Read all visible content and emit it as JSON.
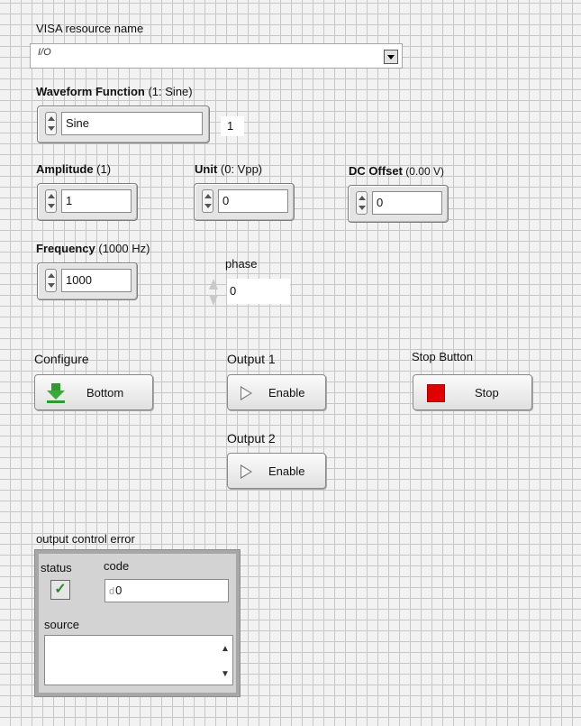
{
  "visa": {
    "label": "VISA resource name",
    "io_glyph": "I/O",
    "value": ""
  },
  "waveform": {
    "label_bold": "Waveform Function",
    "label_extra": " (1: Sine)",
    "value": "Sine",
    "index": "1"
  },
  "amplitude": {
    "label_bold": "Amplitude",
    "label_extra": " (1)",
    "value": "1"
  },
  "unit": {
    "label_bold": "Unit",
    "label_extra": " (0: Vpp)",
    "value": "0"
  },
  "dc_offset": {
    "label_bold": "DC Offset",
    "label_extra": " (0.00 V)",
    "value": "0"
  },
  "frequency": {
    "label_bold": "Frequency",
    "label_extra": " (1000 Hz)",
    "value": "1000"
  },
  "phase": {
    "label": "phase",
    "value": "0"
  },
  "configure": {
    "label": "Configure",
    "button": "Bottom"
  },
  "output1": {
    "label": "Output 1",
    "button": "Enable"
  },
  "output2": {
    "label": "Output 2",
    "button": "Enable"
  },
  "stop": {
    "label": "Stop Button",
    "button": "Stop"
  },
  "error": {
    "label": "output control error",
    "status_label": "status",
    "code_label": "code",
    "code_radix": "d",
    "code_value": "0",
    "source_label": "source",
    "status_glyph": "✓"
  },
  "colors": {
    "stop_red": "#e00000",
    "configure_green": "#3aa83a",
    "grid": "#c6c6c6"
  }
}
